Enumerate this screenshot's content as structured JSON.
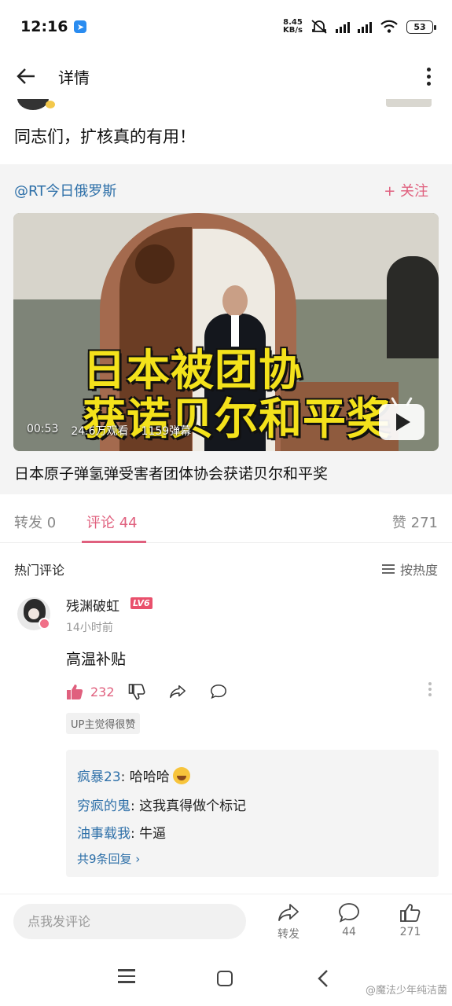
{
  "status_bar": {
    "time": "12:16",
    "net_speed_value": "8.45",
    "net_speed_unit": "KB/s",
    "battery": "53",
    "signal_labels": [
      "HD",
      "HD"
    ],
    "wifi_sub": "6"
  },
  "nav": {
    "title": "详情"
  },
  "post": {
    "text": "同志们，扩核真的有用！"
  },
  "repost": {
    "author": "@RT今日俄罗斯",
    "follow_label": "+ 关注",
    "video": {
      "caption_line1": "日本被团协",
      "caption_line2": "获诺贝尔和平奖",
      "duration": "00:53",
      "views": "24.6万观看",
      "danmaku": "1159弹幕"
    },
    "title": "日本原子弹氢弹受害者团体协会获诺贝尔和平奖"
  },
  "tabs": {
    "repost": "转发 0",
    "comment": "评论 44",
    "like": "赞 271"
  },
  "comments_header": {
    "title": "热门评论",
    "sort_label": "按热度"
  },
  "comment": {
    "username": "残渊破虹",
    "level": "LV6",
    "time": "14小时前",
    "text": "高温补贴",
    "like_count": "232",
    "up_tag": "UP主觉得很赞",
    "replies": [
      {
        "user": "疯暴23",
        "sep": ": ",
        "text": "哈哈哈"
      },
      {
        "user": "穷疯的鬼",
        "sep": ": ",
        "text": "这我真得做个标记"
      },
      {
        "user": "油事载我",
        "sep": ": ",
        "text": "牛逼"
      }
    ],
    "more_replies": "共9条回复 ›"
  },
  "bottom_bar": {
    "input_placeholder": "点我发评论",
    "repost_label": "转发",
    "comment_count": "44",
    "like_count": "271"
  },
  "watermark": "@魔法少年纯洁菌",
  "colors": {
    "accent_pink": "#e0607e",
    "link_blue": "#2d6fa8",
    "caption_yellow": "#f4e21b"
  },
  "icons": [
    "back-arrow-icon",
    "more-vertical-icon",
    "plus-icon",
    "play-icon",
    "sort-icon",
    "thumb-up-icon",
    "thumb-down-icon",
    "share-icon",
    "reply-bubble-icon",
    "chevron-right-icon",
    "menu-icon",
    "home-icon",
    "back-icon"
  ]
}
